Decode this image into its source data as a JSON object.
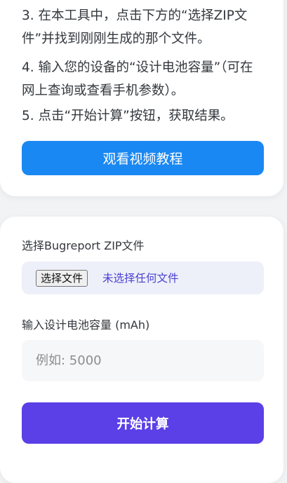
{
  "instructions": {
    "step3": "3. 在本工具中，点击下方的“选择ZIP文件”并找到刚刚生成的那个文件。",
    "step4": "4. 输入您的设备的“设计电池容量”（可在网上查询或查看手机参数）。",
    "step5": "5. 点击“开始计算”按钮，获取结果。",
    "video_button_label": "观看视频教程"
  },
  "form": {
    "zip_label": "选择Bugreport ZIP文件",
    "file_button_label": "选择文件",
    "file_status": "未选择任何文件",
    "capacity_label": "输入设计电池容量 (mAh)",
    "capacity_placeholder": "例如: 5000",
    "capacity_value": "",
    "submit_label": "开始计算"
  },
  "colors": {
    "video_button": "#1a88f2",
    "submit_button": "#5a40e6",
    "file_status_text": "#4a3fd0"
  }
}
